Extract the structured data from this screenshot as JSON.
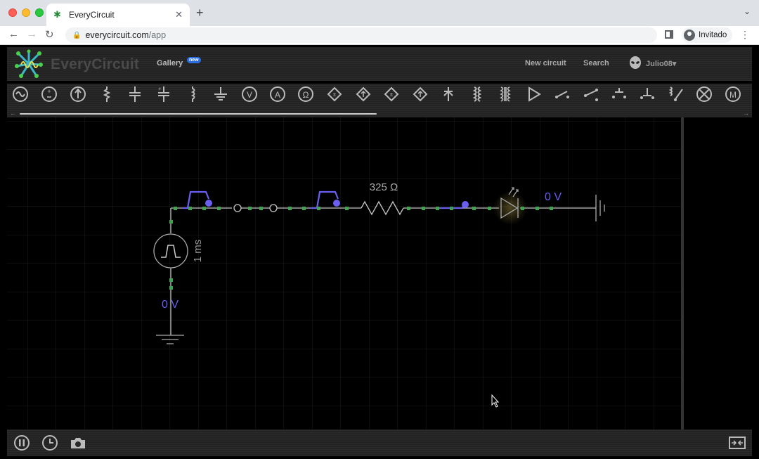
{
  "browser": {
    "tab_title": "EveryCircuit",
    "url_domain": "everycircuit.com",
    "url_path": "/app",
    "profile_label": "Invitado"
  },
  "app": {
    "brand": "EveryCircuit",
    "gallery": "Gallery",
    "gallery_badge": "new",
    "new_circuit": "New circuit",
    "search": "Search",
    "user": "Julio08",
    "palette": [
      "ac-source-icon",
      "dc-source-icon",
      "current-source-icon",
      "resistor-icon",
      "capacitor-icon",
      "polarized-capacitor-icon",
      "inductor-icon",
      "ground-icon",
      "voltmeter-icon",
      "ammeter-icon",
      "ohmmeter-icon",
      "vcvs-icon",
      "vccs-icon",
      "ccvs-icon",
      "cccs-icon",
      "diode-icon",
      "transformer-icon",
      "transformer-core-icon",
      "amplifier-icon",
      "switch-spst-icon",
      "switch-spdt-icon",
      "push-button-no-icon",
      "push-button-nc-icon",
      "relay-icon",
      "lamp-icon",
      "motor-icon"
    ]
  },
  "circuit": {
    "resistor_label": "325 Ω",
    "pulse_label": "1 ms",
    "output_voltage": "0 V",
    "source_voltage": "0 V"
  },
  "colors": {
    "wire": "#c8c8c8",
    "node": "#3fa34d",
    "signal": "#6a5ff0",
    "grid": "#1c1c1c"
  }
}
